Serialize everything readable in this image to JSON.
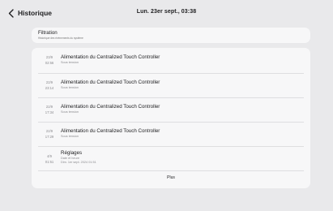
{
  "header": {
    "back_label": "Historique",
    "datetime": "Lun. 23er sept., 03:38"
  },
  "filter": {
    "title": "Filtration",
    "subtitle": "Historique des événements du système"
  },
  "events": [
    {
      "date": "23/9",
      "time": "02:56",
      "title": "Alimentation du Centralized Touch Controller",
      "sub": "Sous tension"
    },
    {
      "date": "22/9",
      "time": "23:14",
      "title": "Alimentation du Centralized Touch Controller",
      "sub": "Sous tension"
    },
    {
      "date": "22/9",
      "time": "17:34",
      "title": "Alimentation du Centralized Touch Controller",
      "sub": "Sous tension"
    },
    {
      "date": "22/9",
      "time": "17:29",
      "title": "Alimentation du Centralized Touch Controller",
      "sub": "Sous tension"
    },
    {
      "date": "4/9",
      "time": "01:51",
      "title": "Réglages",
      "sub": "Date et heure",
      "sub2": "Dim. 1er sept. 2024 01:51"
    }
  ],
  "more_label": "Plus",
  "icons": {
    "back": "chevron-left-icon"
  }
}
